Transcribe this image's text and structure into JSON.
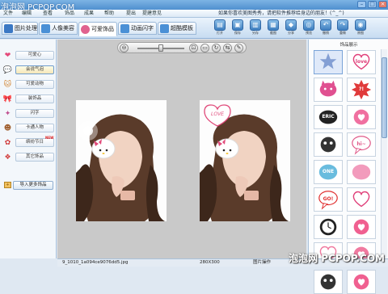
{
  "window": {
    "watermark_top": "泡泡网 PCPOP.COM",
    "notice": "如果你喜欢美图秀秀，请把软件推荐给身边的朋友！(^_^)"
  },
  "menu": [
    {
      "label": "文件"
    },
    {
      "label": "编辑"
    },
    {
      "label": "查看"
    },
    {
      "label": "饰品"
    },
    {
      "label": "成果"
    },
    {
      "label": "帮助"
    },
    {
      "label": "提出"
    },
    {
      "label": "提建意见"
    }
  ],
  "tabs": [
    {
      "label": "图片处理",
      "color": "#3b78c4"
    },
    {
      "label": "人像美容",
      "color": "#4a90d6"
    },
    {
      "label": "可爱饰品",
      "color": "#e0628f"
    },
    {
      "label": "动画闪字",
      "color": "#4a90d6"
    },
    {
      "label": "超酷模板",
      "color": "#4a90d6"
    }
  ],
  "tools": [
    {
      "label": "打开",
      "icon": "folder-icon",
      "glyph": "▤"
    },
    {
      "label": "保存",
      "icon": "save-icon",
      "glyph": "▣"
    },
    {
      "label": "另存",
      "icon": "save-as-icon",
      "glyph": "▥"
    },
    {
      "label": "截图",
      "icon": "screenshot-icon",
      "glyph": "▦"
    },
    {
      "label": "分享",
      "icon": "share-icon",
      "glyph": "◆"
    },
    {
      "label": "预览",
      "icon": "preview-icon",
      "glyph": "◎"
    },
    {
      "label": "撤销",
      "icon": "undo-icon",
      "glyph": "↶"
    },
    {
      "label": "重做",
      "icon": "redo-icon",
      "glyph": "↷"
    },
    {
      "label": "原图",
      "icon": "original-icon",
      "glyph": "◉"
    }
  ],
  "categories": [
    {
      "label": "可爱心",
      "icon": "heart-icon",
      "glyph": "❤",
      "color": "#e44a7a"
    },
    {
      "label": "会说气泡",
      "icon": "speech-bubble-icon",
      "glyph": "💬",
      "color": "#5b8ed0"
    },
    {
      "label": "可爱动物",
      "icon": "animal-icon",
      "glyph": "🐱",
      "color": "#d0802a"
    },
    {
      "label": "装饰品",
      "icon": "bow-icon",
      "glyph": "🎀",
      "color": "#d83a6e"
    },
    {
      "label": "闪字",
      "icon": "sparkle-icon",
      "glyph": "✦",
      "color": "#c05090"
    },
    {
      "label": "卡通人物",
      "icon": "cartoon-icon",
      "glyph": "☻",
      "color": "#a06030"
    },
    {
      "label": "缤纷节日",
      "icon": "festival-icon",
      "glyph": "✿",
      "color": "#d03a3a",
      "badge": "NEW"
    },
    {
      "label": "其它饰品",
      "icon": "gift-icon",
      "glyph": "❖",
      "color": "#d03a3a"
    }
  ],
  "import_button": "导入更多饰品",
  "right_panel": {
    "title": "饰品展示",
    "stickers": [
      {
        "text": "",
        "icon": "star-sticker",
        "bg": "#dfe9f9",
        "fg": "#5b7fc4",
        "shape": "star"
      },
      {
        "text": "love",
        "icon": "heart-bubble-sticker",
        "bg": "#fff",
        "fg": "#e0407a",
        "shape": "heart"
      },
      {
        "text": "",
        "icon": "pink-cat-sticker",
        "bg": "#fff",
        "fg": "#e05090",
        "shape": "cat"
      },
      {
        "text": "?!",
        "icon": "red-bubble-sticker",
        "bg": "#fff",
        "fg": "#e03a3a",
        "shape": "burst"
      },
      {
        "text": "ERIC",
        "icon": "black-blob-sticker",
        "bg": "#fff",
        "fg": "#222",
        "shape": "blob"
      },
      {
        "text": "",
        "icon": "pink-heart-sticker",
        "bg": "#fff",
        "fg": "#f070a0",
        "shape": "circle"
      },
      {
        "text": "",
        "icon": "dark-bubble-sticker",
        "bg": "#fff",
        "fg": "#333",
        "shape": "dark"
      },
      {
        "text": "hi~",
        "icon": "hi-bubble-sticker",
        "bg": "#fff",
        "fg": "#e05a8a",
        "shape": "speech"
      },
      {
        "text": "ONE",
        "icon": "one-sticker",
        "bg": "#fff",
        "fg": "#4fb0d8",
        "shape": "cloud"
      },
      {
        "text": "",
        "icon": "pink-heart-bubble-sticker",
        "bg": "#fff",
        "fg": "#f08ab0",
        "shape": "cloud"
      },
      {
        "text": "GO!",
        "icon": "go-sticker",
        "bg": "#fff",
        "fg": "#e03030",
        "shape": "speech"
      },
      {
        "text": "",
        "icon": "heart-speech-sticker",
        "bg": "#fff",
        "fg": "#e0407a",
        "shape": "heart"
      },
      {
        "text": "",
        "icon": "clock-sticker",
        "bg": "#fff",
        "fg": "#222",
        "shape": "clock"
      },
      {
        "text": "",
        "icon": "pink-bubble-sticker",
        "bg": "#fff",
        "fg": "#f06090",
        "shape": "circle"
      },
      {
        "text": "",
        "icon": "pink-heart-small-sticker",
        "bg": "#fff",
        "fg": "#f07aa0",
        "shape": "heart"
      },
      {
        "text": "",
        "icon": "pink-sticker",
        "bg": "#fff",
        "fg": "#f07aa0",
        "shape": "circle"
      },
      {
        "text": "",
        "icon": "dark-sticker",
        "bg": "#fff",
        "fg": "#333",
        "shape": "dark"
      },
      {
        "text": "",
        "icon": "pink-round-sticker",
        "bg": "#fff",
        "fg": "#f06090",
        "shape": "circle"
      }
    ]
  },
  "status": {
    "filename": "9_1010_1a094ce9076dd5.jpg",
    "dimensions": "280X300",
    "operation": "图片操作"
  },
  "photo_sticker_text": "LOVE",
  "watermark": "泡泡网 PCPOP.COM"
}
